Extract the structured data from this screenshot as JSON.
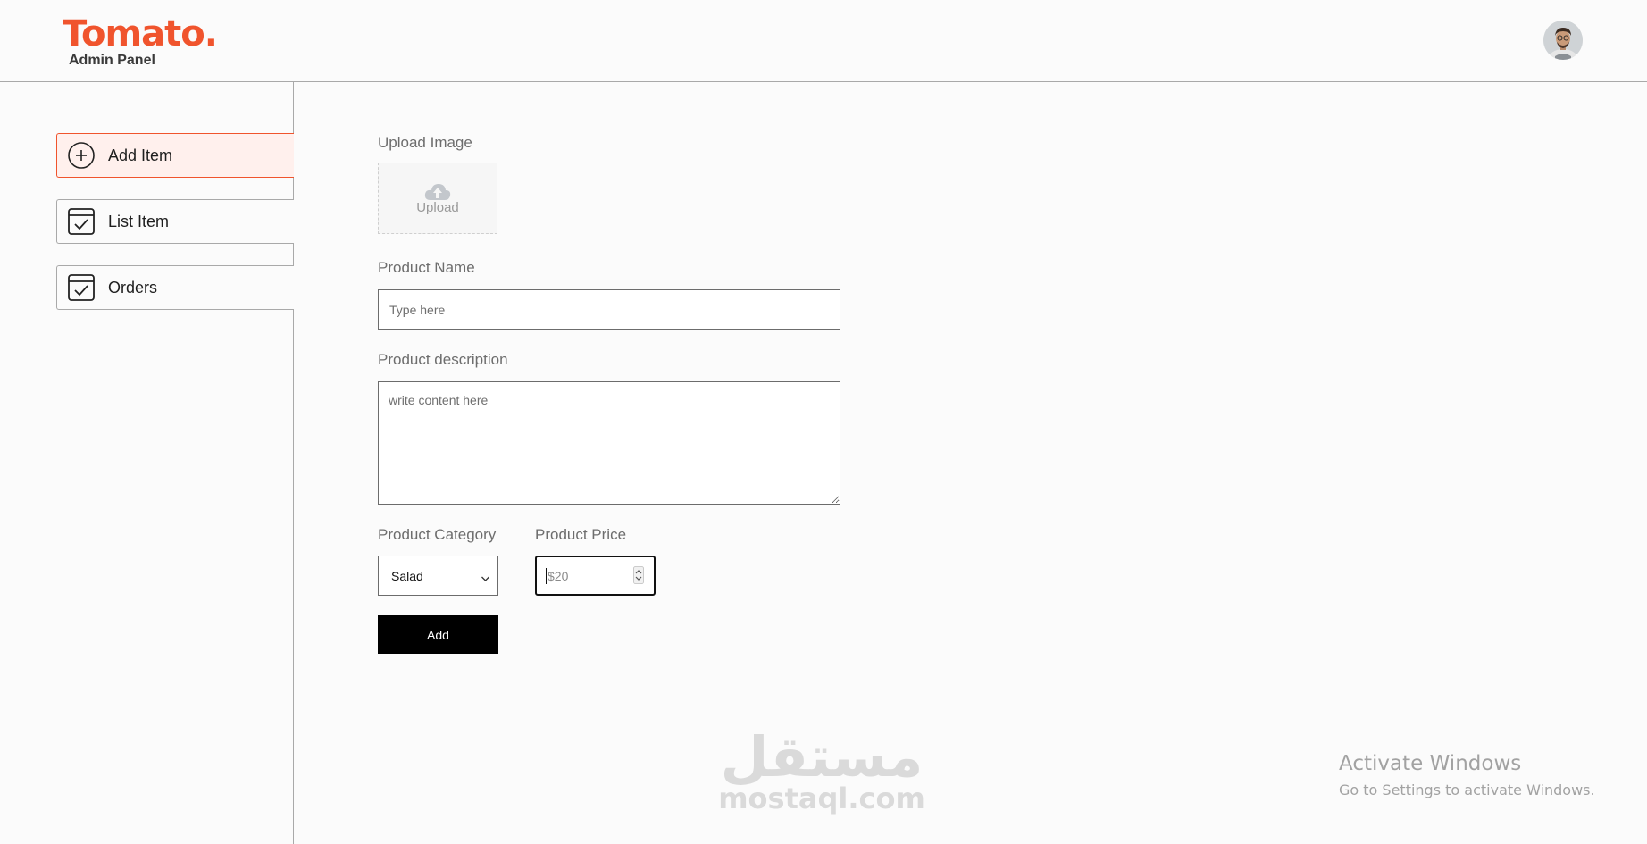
{
  "header": {
    "logo_title": "Tomato.",
    "logo_subtitle": "Admin Panel",
    "avatar_icon": "profile-avatar",
    "brand_color": "#f0542d"
  },
  "sidebar": {
    "items": [
      {
        "label": "Add Item",
        "icon": "add-circle-icon",
        "active": true
      },
      {
        "label": "List Item",
        "icon": "checklist-icon",
        "active": false
      },
      {
        "label": "Orders",
        "icon": "checklist-icon",
        "active": false
      }
    ]
  },
  "form": {
    "upload_label": "Upload Image",
    "upload_text": "Upload",
    "name_label": "Product Name",
    "name_placeholder": "Type here",
    "name_value": "",
    "description_label": "Product description",
    "description_placeholder": "write content here",
    "description_value": "",
    "category_label": "Product Category",
    "category_value": "Salad",
    "price_label": "Product Price",
    "price_placeholder": "$20",
    "add_button": "Add"
  },
  "overlay": {
    "watermark_arabic": "مستقل",
    "watermark_domain": "mostaql.com",
    "activate_title": "Activate Windows",
    "activate_subtitle": "Go to Settings to activate Windows."
  }
}
